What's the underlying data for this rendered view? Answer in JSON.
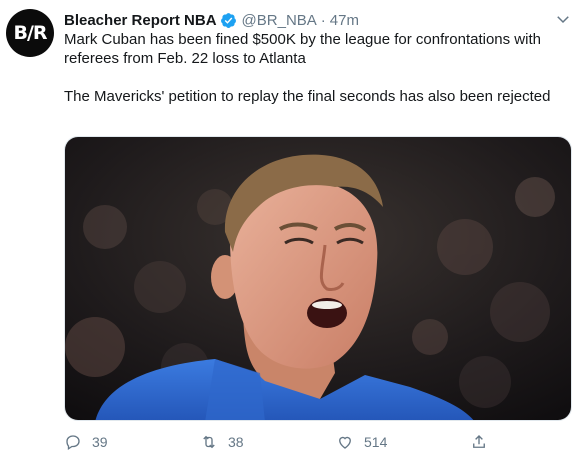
{
  "tweet": {
    "avatar_text": "B/R",
    "display_name": "Bleacher Report NBA",
    "handle": "@BR_NBA",
    "separator": "·",
    "time": "47m",
    "paragraphs": [
      "Mark Cuban has been fined $500K by the league for confrontations with referees from Feb. 22 loss to Atlanta",
      "The Mavericks' petition to replay the final seconds has also been rejected"
    ],
    "media_alt": "Photo of Mark Cuban yelling, wearing a blue shirt, at a basketball game"
  },
  "actions": {
    "replies": "39",
    "retweets": "38",
    "likes": "514"
  },
  "colors": {
    "text": "#14171a",
    "secondary": "#657786",
    "verified": "#1da1f2",
    "shirt": "#2f6fd6"
  },
  "icons": [
    "reply-icon",
    "retweet-icon",
    "like-icon",
    "share-icon",
    "verified-icon",
    "caret-down-icon"
  ]
}
